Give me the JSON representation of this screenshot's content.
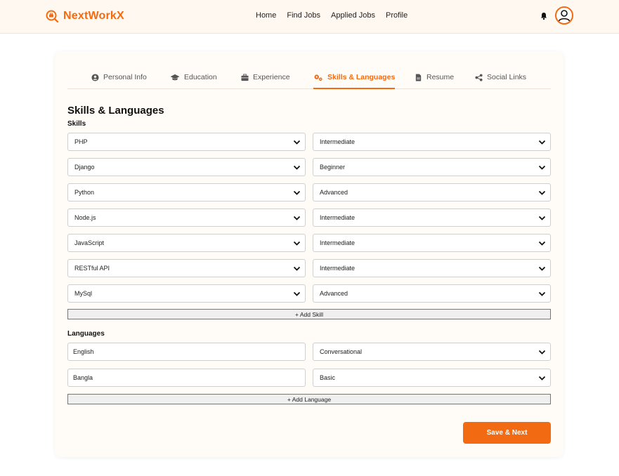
{
  "brand": {
    "name": "NextWorkX",
    "color": "#f26b12"
  },
  "nav": {
    "home": "Home",
    "find_jobs": "Find Jobs",
    "applied_jobs": "Applied Jobs",
    "profile": "Profile"
  },
  "tabs": [
    {
      "label": "Personal Info",
      "icon": "user-circle-icon"
    },
    {
      "label": "Education",
      "icon": "graduation-cap-icon"
    },
    {
      "label": "Experience",
      "icon": "briefcase-icon"
    },
    {
      "label": "Skills & Languages",
      "icon": "gears-icon",
      "active": true
    },
    {
      "label": "Resume",
      "icon": "file-icon"
    },
    {
      "label": "Social Links",
      "icon": "share-icon"
    }
  ],
  "section": {
    "title": "Skills & Languages",
    "skills_label": "Skills",
    "languages_label": "Languages"
  },
  "skills": [
    {
      "name": "PHP",
      "level": "Intermediate"
    },
    {
      "name": "Django",
      "level": "Beginner"
    },
    {
      "name": "Python",
      "level": "Advanced"
    },
    {
      "name": "Node.js",
      "level": "Intermediate"
    },
    {
      "name": "JavaScript",
      "level": "Intermediate"
    },
    {
      "name": "RESTful API",
      "level": "Intermediate"
    },
    {
      "name": "MySql",
      "level": "Advanced"
    }
  ],
  "add_skill_label": "+ Add Skill",
  "languages": [
    {
      "name": "English",
      "level": "Conversational"
    },
    {
      "name": "Bangla",
      "level": "Basic"
    }
  ],
  "add_language_label": "+ Add Language",
  "save_label": "Save & Next"
}
